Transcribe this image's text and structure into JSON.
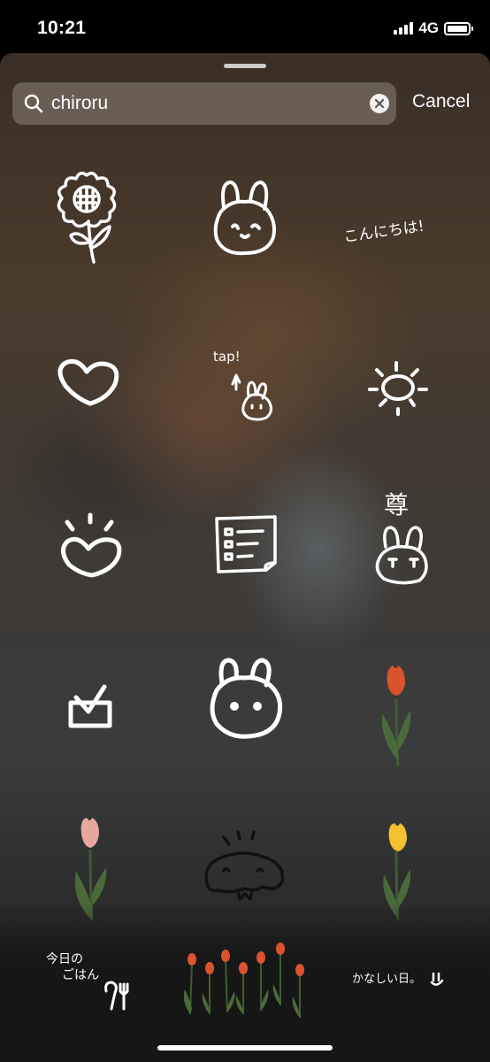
{
  "status_bar": {
    "time": "10:21",
    "network": "4G"
  },
  "search": {
    "query": "chiroru",
    "cancel_label": "Cancel"
  },
  "stickers": {
    "konnichiwa_text": "こんにちは!",
    "tap_text": "tap!",
    "honor_text": "尊",
    "lunch_text_1": "今日の",
    "lunch_text_2": "ごはん",
    "kanashii_text": "かなしい日。"
  },
  "colors": {
    "sheet_accent": "#4a3a2b",
    "tulip_red": "#d9532f",
    "tulip_pink": "#e8a8a0",
    "tulip_yellow": "#f2c12e",
    "leaf_green": "#4a6a3a"
  }
}
